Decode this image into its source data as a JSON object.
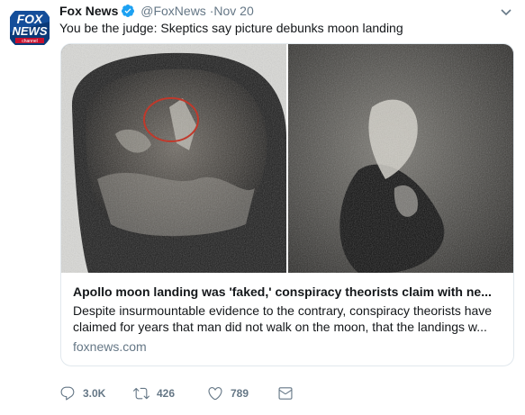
{
  "tweet": {
    "display_name": "Fox News",
    "handle": "@FoxNews",
    "dot": "·",
    "timestamp": "Nov 20",
    "text": "You be the judge: Skeptics say picture debunks moon landing",
    "avatar_logo": {
      "line1": "FOX",
      "line2": "NEWS",
      "line3": "channel"
    },
    "verified_color": "#1da1f2"
  },
  "card": {
    "title": "Apollo moon landing was 'faked,' conspiracy theorists claim with ne...",
    "description": "Despite insurmountable evidence to the contrary, conspiracy theorists have claimed for years that man did not walk on the moon, that the landings w...",
    "domain": "foxnews.com",
    "image_alt": "astronaut-visor-reflection-and-zoomed-detail"
  },
  "actions": {
    "replies": "3.0K",
    "retweets": "426",
    "likes": "789"
  },
  "colors": {
    "secondary_text": "#657786",
    "border": "#e1e8ed",
    "highlight_circle": "#c0392b"
  }
}
